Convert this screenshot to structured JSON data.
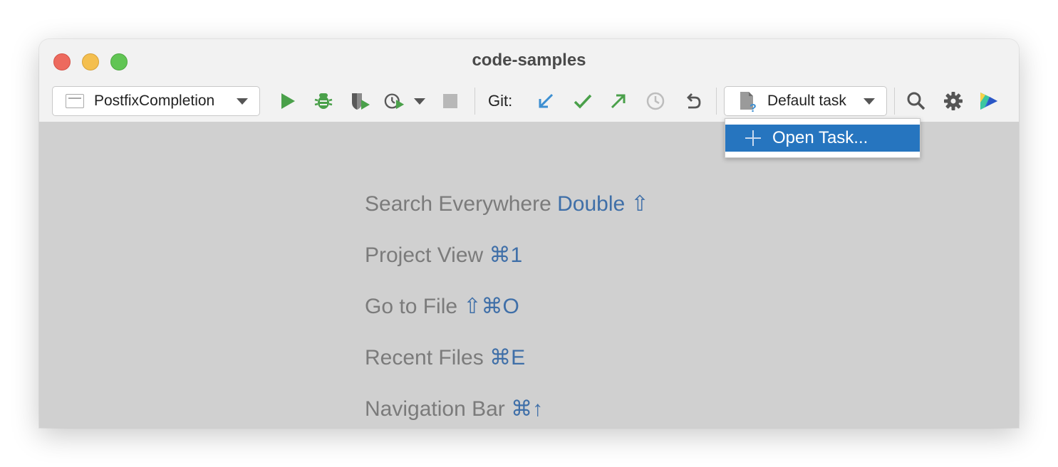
{
  "window": {
    "title": "code-samples"
  },
  "toolbar": {
    "run_config": "PostfixCompletion",
    "git_label": "Git:",
    "task": "Default task",
    "icons": [
      "run-icon",
      "debug-icon",
      "coverage-icon",
      "profile-icon",
      "stop-icon",
      "git-update-icon",
      "git-commit-icon",
      "git-push-icon",
      "history-icon",
      "rollback-icon",
      "search-icon",
      "settings-icon",
      "code-with-me-icon"
    ]
  },
  "task_menu": {
    "items": [
      {
        "label": "Open Task..."
      }
    ]
  },
  "hints": [
    {
      "text": "Search Everywhere",
      "key": "Double ⇧"
    },
    {
      "text": "Project View",
      "key": "⌘1"
    },
    {
      "text": "Go to File",
      "key": "⇧⌘O"
    },
    {
      "text": "Recent Files",
      "key": "⌘E"
    },
    {
      "text": "Navigation Bar",
      "key": "⌘↑"
    }
  ],
  "colors": {
    "accent": "#2675bf",
    "run_green": "#4aa04a",
    "shortcut_blue": "#3f6fa8",
    "git_update_blue": "#3d8fd1"
  }
}
